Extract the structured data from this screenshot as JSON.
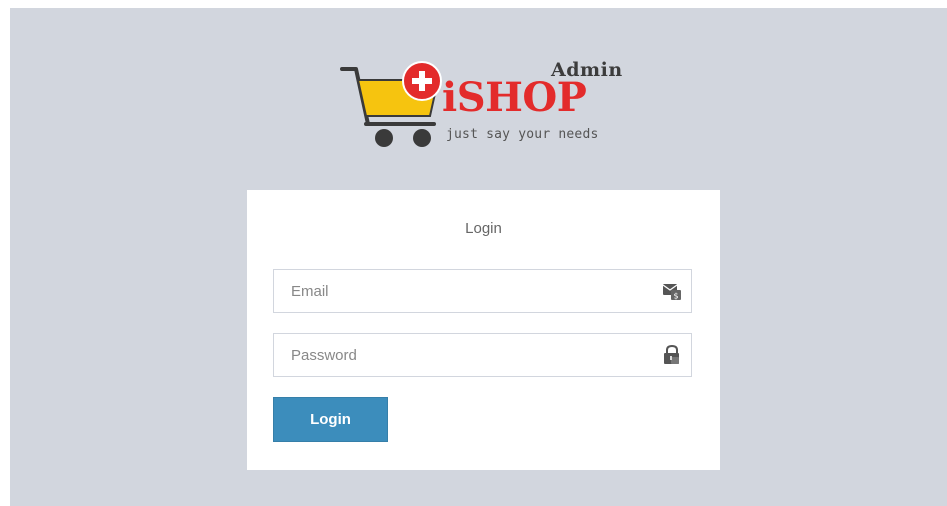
{
  "logo": {
    "admin_label": "Admin",
    "brand_name": "iSHOP",
    "tagline": "just say your needs",
    "colors": {
      "brand_red": "#e32b2b",
      "cart_yellow": "#f6c40f",
      "cart_frame": "#3a3a3a"
    }
  },
  "login": {
    "title": "Login",
    "email": {
      "placeholder": "Email",
      "value": "",
      "icon": "envelope-icon"
    },
    "password": {
      "placeholder": "Password",
      "value": "",
      "icon": "lock-icon"
    },
    "submit_label": "Login"
  },
  "colors": {
    "page_background": "#d2d6de",
    "box_background": "#ffffff",
    "button_primary": "#3c8dbc"
  }
}
